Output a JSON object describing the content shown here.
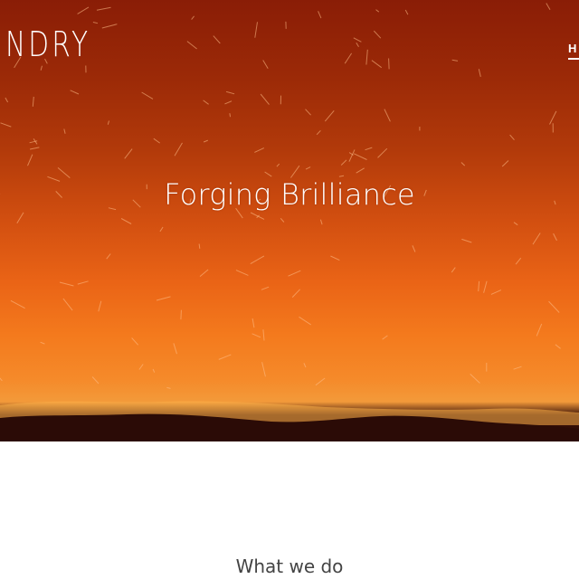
{
  "header": {
    "logo_text": "NDRY",
    "nav_visible_label": "H"
  },
  "hero": {
    "headline": "Forging Brilliance",
    "colors": {
      "top": "#8a1d06",
      "middle": "#d24f10",
      "glow": "#f58a2a",
      "horizon": "#2a0a05"
    }
  },
  "section": {
    "title": "What we do"
  }
}
